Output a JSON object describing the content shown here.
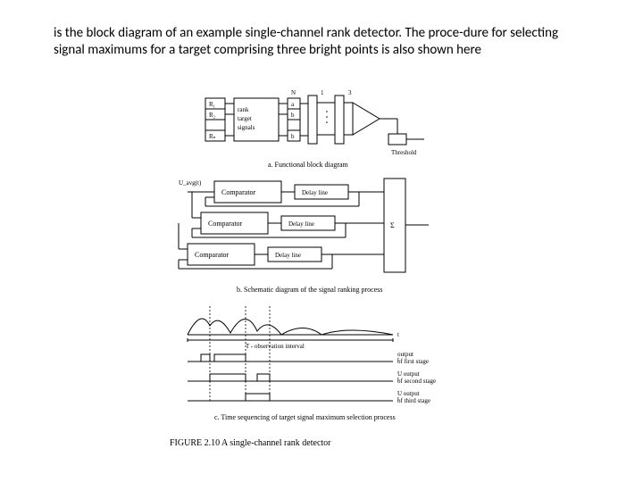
{
  "caption": "is the block diagram of an example single-channel rank detector. The proce-dure for selecting signal maximums for a target comprising three bright points is also shown here",
  "panelA": {
    "topN": "N",
    "right1": "1",
    "right3": "3",
    "leftCells": [
      "R₁",
      "R₂",
      "",
      "Rₙ"
    ],
    "rankBlock": "rank target signals",
    "midCells": [
      "a",
      "b",
      "",
      "b"
    ],
    "threshold": "Threshold",
    "title": "a. Functional block diagram"
  },
  "panelB": {
    "u": "U_avg(t)",
    "comp": "Comparator",
    "delay": "Delay line",
    "sigma": "Σ",
    "title": "b. Schematic diagram of the signal ranking process"
  },
  "panelC": {
    "obs": "T - observation interval",
    "tAxis": "t",
    "out1a": "output",
    "out1b": "of first stage",
    "out2a": "U output",
    "out2b": "of second stage",
    "out3a": "U output",
    "out3b": "of third stage",
    "title": "c. Time sequencing of target signal maximum selection process"
  },
  "figureCaption": "FIGURE 2.10  A single-channel rank detector"
}
